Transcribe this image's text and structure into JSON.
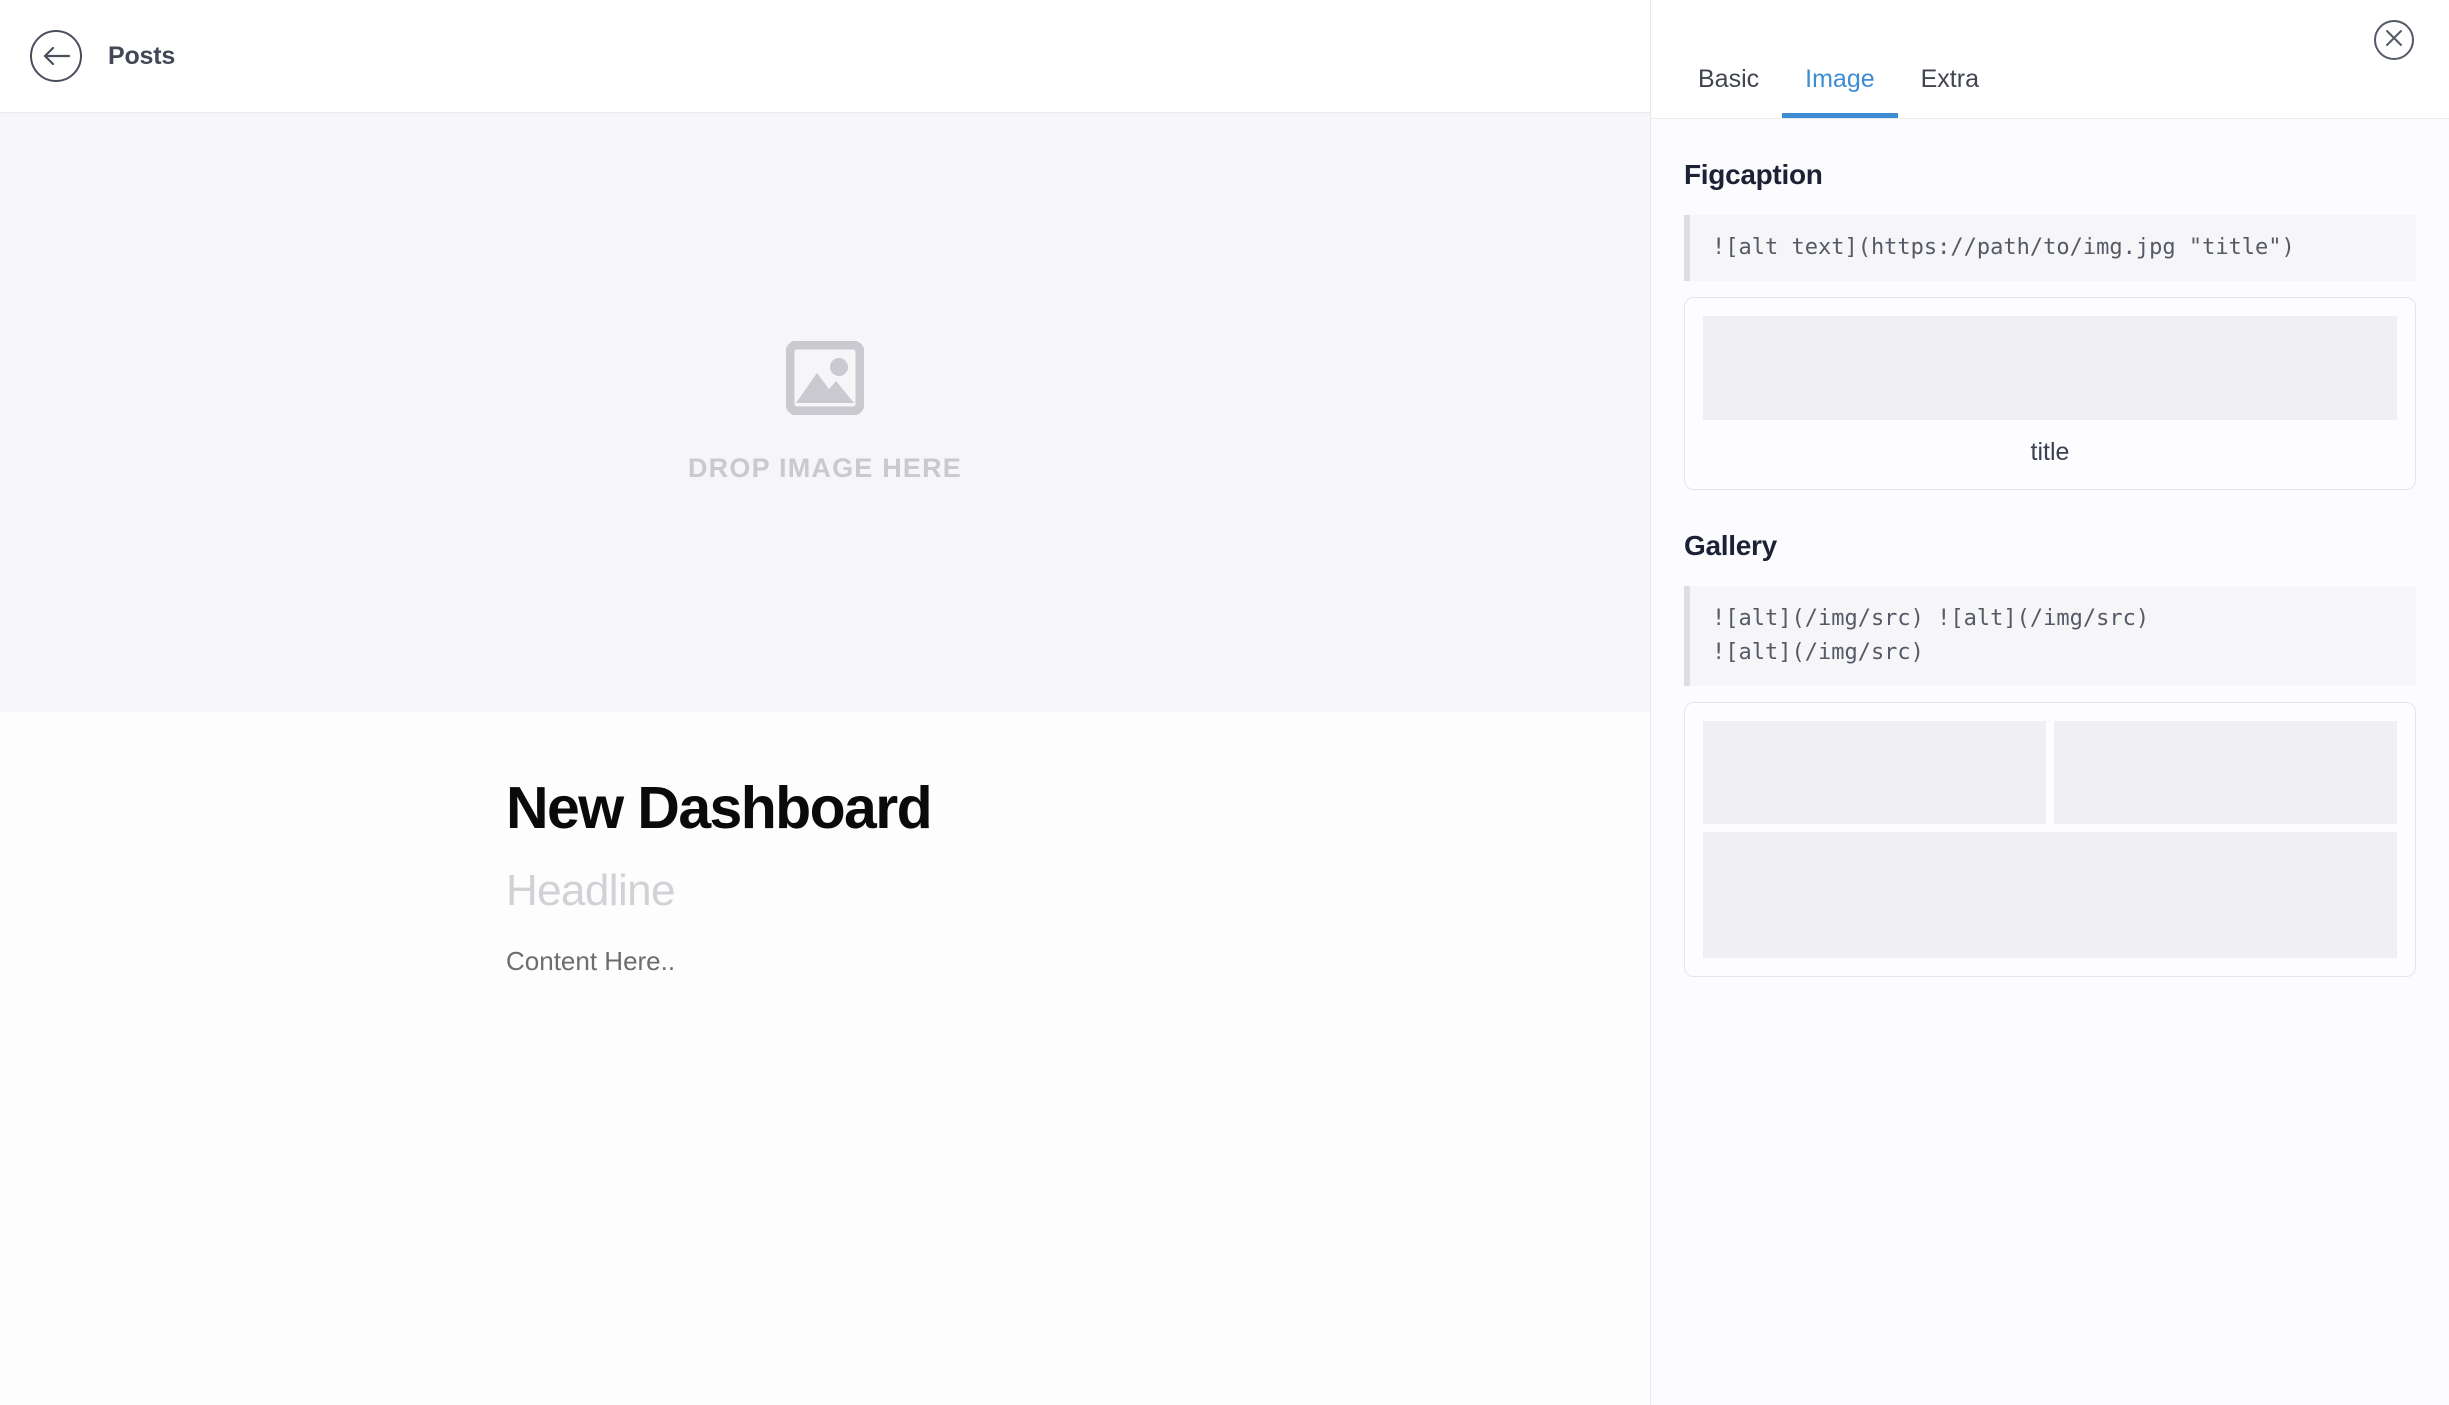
{
  "editor": {
    "header": {
      "back_icon": "arrow-left-icon",
      "title": "Posts"
    },
    "dropzone": {
      "icon": "image-placeholder-icon",
      "label": "DROP IMAGE HERE"
    },
    "document": {
      "title": "New Dashboard",
      "headline_placeholder": "Headline",
      "content_placeholder": "Content Here.."
    }
  },
  "panel": {
    "tabs": [
      {
        "label": "Basic",
        "active": false
      },
      {
        "label": "Image",
        "active": true
      },
      {
        "label": "Extra",
        "active": false
      }
    ],
    "close_icon": "close-circle-icon",
    "sections": [
      {
        "title": "Figcaption",
        "code": "![alt text](https://path/to/img.jpg \"title\")",
        "preview_caption": "title"
      },
      {
        "title": "Gallery",
        "code": "![alt](/img/src) ![alt](/img/src)\n![alt](/img/src)",
        "preview_caption": ""
      }
    ]
  },
  "colors": {
    "accent": "#3d8cd4",
    "header_text": "#434857",
    "section_title": "#1c2135",
    "code_text": "#555a66",
    "code_bg": "#f6f6f8",
    "dropzone_bg": "#f6f5f8",
    "dropzone_text": "#c9c9cf",
    "placeholder_gray": "#f0eff2",
    "doc_title": "#0a0a0a",
    "doc_headline": "#d2d2d6",
    "doc_content": "#6d6d6d"
  }
}
